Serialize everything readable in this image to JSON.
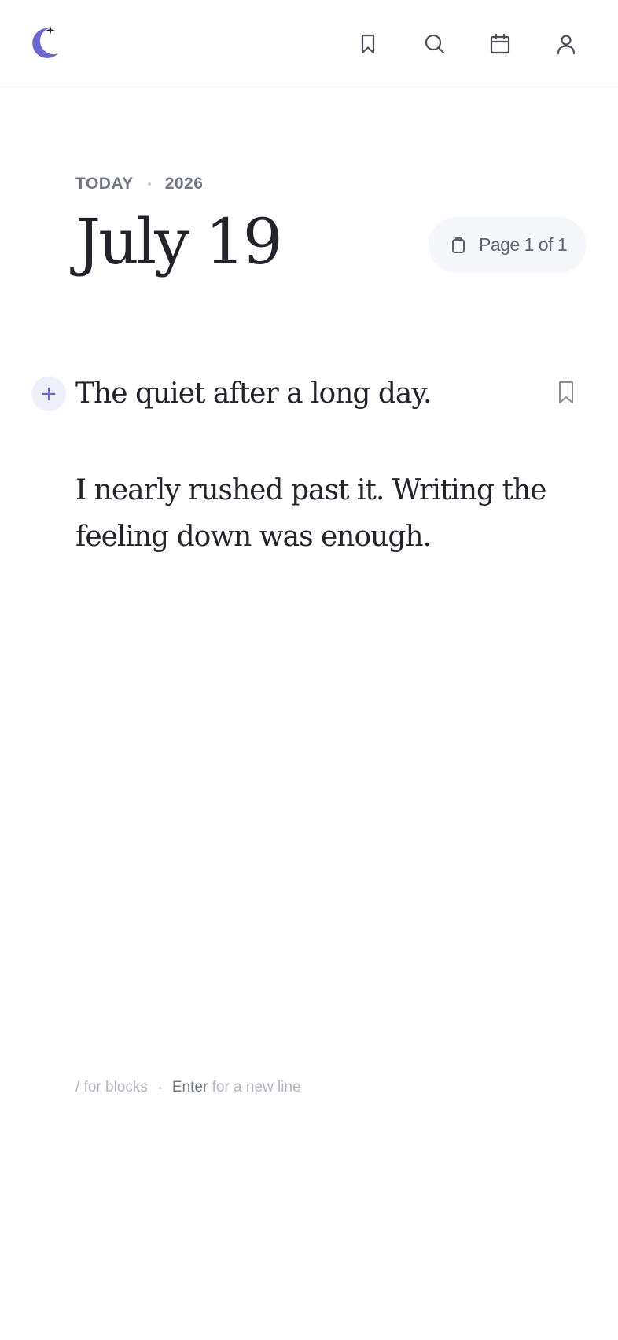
{
  "header": {
    "logo_icon": "crescent-moon-star-icon",
    "nav": [
      {
        "name": "bookmarks",
        "icon": "bookmark-icon"
      },
      {
        "name": "search",
        "icon": "search-icon"
      },
      {
        "name": "calendar",
        "icon": "calendar-icon"
      },
      {
        "name": "profile",
        "icon": "user-icon"
      }
    ]
  },
  "entry": {
    "day_label": "TODAY",
    "year": "2026",
    "date": "July 19",
    "page_indicator": "Page 1 of 1",
    "heading": "The quiet after a long day.",
    "body": "I nearly rushed past it. Writing the feeling down was enough."
  },
  "hint": {
    "slash_key": "/",
    "slash_text": "for blocks",
    "enter_key": "Enter",
    "enter_text": "for a new line"
  },
  "colors": {
    "accent": "#6a67cf",
    "text": "#23242b",
    "muted": "#727582",
    "divider": "#ececf0",
    "pill_bg": "#f6f7fa"
  }
}
